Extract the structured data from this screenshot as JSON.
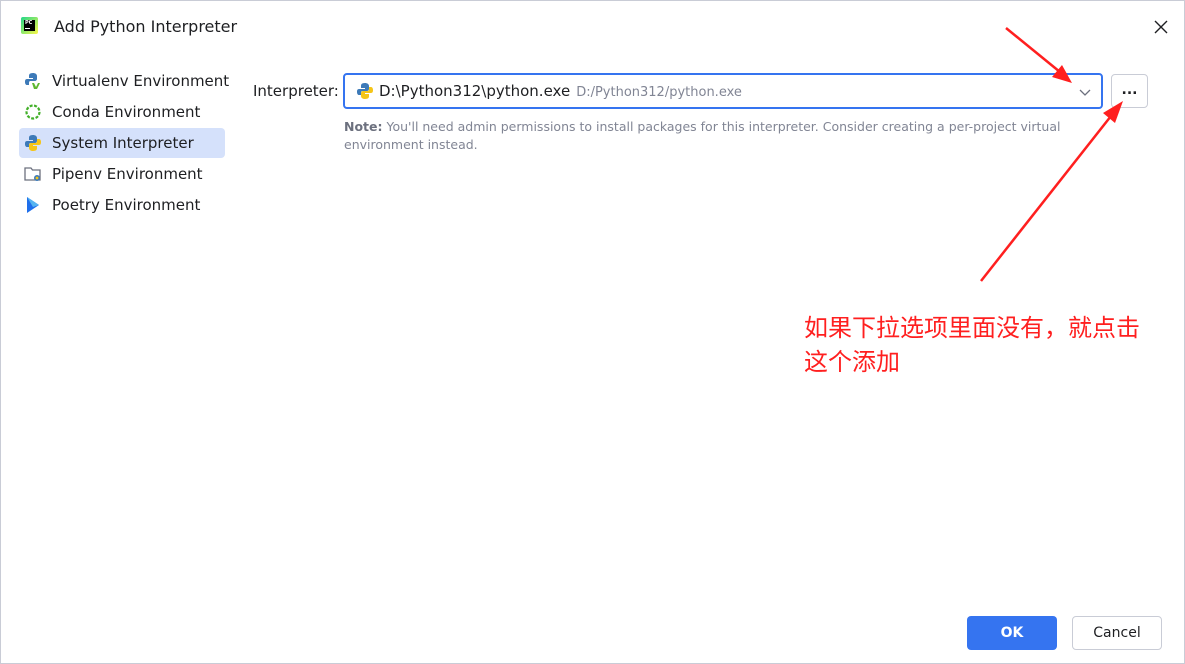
{
  "window": {
    "title": "Add Python Interpreter"
  },
  "sidebar": {
    "items": [
      {
        "label": "Virtualenv Environment",
        "icon": "virtualenv-icon",
        "selected": false
      },
      {
        "label": "Conda Environment",
        "icon": "conda-icon",
        "selected": false
      },
      {
        "label": "System Interpreter",
        "icon": "python-icon",
        "selected": true
      },
      {
        "label": "Pipenv Environment",
        "icon": "pipenv-icon",
        "selected": false
      },
      {
        "label": "Poetry Environment",
        "icon": "poetry-icon",
        "selected": false
      }
    ]
  },
  "main": {
    "interpreter_label": "Interpreter:",
    "interpreter_value": "D:\\Python312\\python.exe",
    "interpreter_path_hint": "D:/Python312/python.exe",
    "browse_label": "...",
    "note_prefix": "Note:",
    "note_text": " You'll need admin permissions to install packages for this interpreter. Consider creating a per-project virtual environment instead."
  },
  "annotation": {
    "line1": "如果下拉选项里面没有，就点击",
    "line2": "这个添加",
    "color": "#ff1f1f"
  },
  "footer": {
    "ok_label": "OK",
    "cancel_label": "Cancel"
  },
  "colors": {
    "accent": "#3574f0",
    "selected_bg": "#d5e1fb",
    "muted_text": "#818594"
  }
}
